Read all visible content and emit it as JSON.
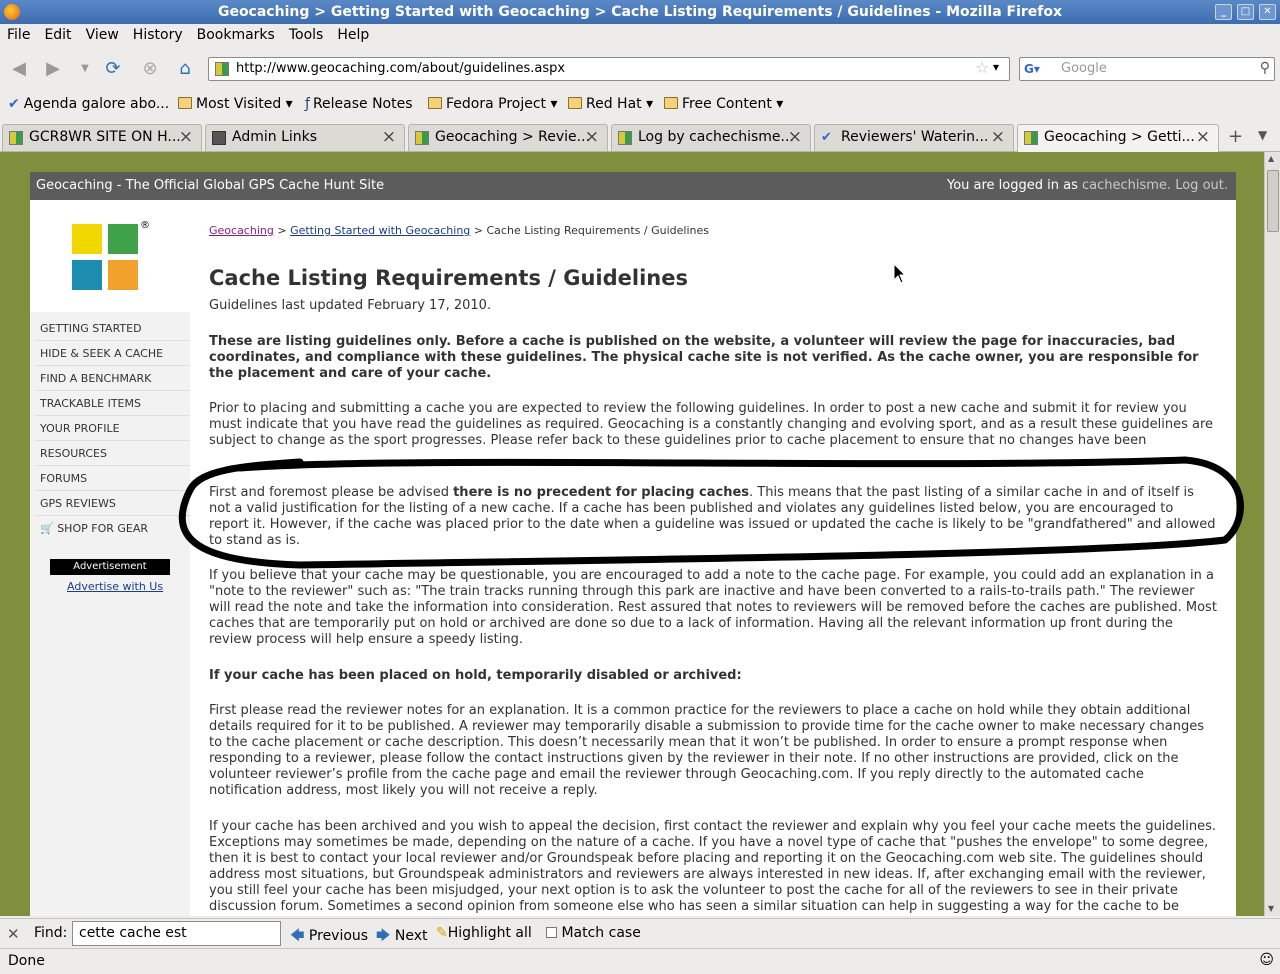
{
  "window": {
    "title": "Geocaching > Getting Started with Geocaching > Cache Listing Requirements / Guidelines - Mozilla Firefox"
  },
  "menu": [
    "File",
    "Edit",
    "View",
    "History",
    "Bookmarks",
    "Tools",
    "Help"
  ],
  "nav": {
    "url": "http://www.geocaching.com/about/guidelines.aspx",
    "search_placeholder": "Google"
  },
  "bookmarks": [
    "Agenda galore abo...",
    "Most Visited",
    "Release Notes",
    "Fedora Project",
    "Red Hat",
    "Free Content"
  ],
  "tabs": [
    {
      "label": "GCR8WR SITE ON H..."
    },
    {
      "label": "Admin Links"
    },
    {
      "label": "Geocaching > Revie..."
    },
    {
      "label": "Log by cachechisme..."
    },
    {
      "label": "Reviewers' Waterin..."
    },
    {
      "label": "Geocaching > Getti..."
    }
  ],
  "site": {
    "header_left": "Geocaching - The Official Global GPS Cache Hunt Site",
    "login_prefix": "You are logged in as",
    "username": "cachechisme.",
    "logout": "Log out."
  },
  "sidebar": {
    "items": [
      "Getting Started",
      "Hide & Seek a Cache",
      "Find a Benchmark",
      "Trackable Items",
      "Your Profile",
      "Resources",
      "Forums",
      "GPS Reviews",
      "Shop for Gear"
    ],
    "ad_label": "Advertisement",
    "ad_link": "Advertise with Us"
  },
  "breadcrumb": {
    "home": "Geocaching",
    "sep": ">",
    "section": "Getting Started with Geocaching",
    "current": "Cache Listing Requirements / Guidelines"
  },
  "article": {
    "title": "Cache Listing Requirements / Guidelines",
    "updated": "Guidelines last updated February 17, 2010.",
    "intro_bold": "These are listing guidelines only. Before a cache is published on the website, a volunteer will review the page for inaccuracies, bad coordinates, and compliance with these guidelines. The physical cache site is not verified. As the cache owner, you are responsible for the placement and care of your cache.",
    "p1": "Prior to placing and submitting a cache you are expected to review the following guidelines. In order to post a new cache and submit it for review you must indicate that you have read the guidelines as required. Geocaching is a constantly changing and evolving sport, and as a result these guidelines are subject to change as the sport progresses. Please refer back to these guidelines prior to cache placement to ensure that no changes have been implemented that would adversely affect your planned cache placement.",
    "p2_a": "First and foremost please be advised ",
    "p2_b": "there is no precedent for placing caches",
    "p2_c": ". This means that the past listing of a similar cache in and of itself is not a valid justification for the listing of a new cache. If a cache has been published and violates any guidelines listed below, you are encouraged to report it. However, if the cache was placed prior to the date when a guideline was issued or updated the cache is likely to be \"grandfathered\" and allowed to stand as is.",
    "p3": "If you believe that your cache may be questionable, you are encouraged to add a note to the cache page. For example, you could add an explanation in a \"note to the reviewer\" such as: \"The train tracks running through this park are inactive and have been converted to a rails-to-trails path.\" The reviewer will read the note and take the information into consideration. Rest assured that notes to reviewers will be removed before the caches are published. Most caches that are temporarily put on hold or archived are done so due to a lack of information. Having all the relevant information up front during the review process will help ensure a speedy listing.",
    "h2": "If your cache has been placed on hold, temporarily disabled or archived:",
    "p4": "First please read the reviewer notes for an explanation. It is a common practice for the reviewers to place a cache on hold while they obtain additional details required for it to be published. A reviewer may temporarily disable a submission to provide time for the cache owner to make necessary changes to the cache placement or cache description. This doesn’t necessarily mean that it won’t be published. In order to ensure a prompt response when responding to a reviewer, please follow the contact instructions given by the reviewer in their note. If no other instructions are provided, click on the volunteer reviewer’s profile from the cache page and email the reviewer through Geocaching.com. If you reply directly to the automated cache notification address, most likely you will not receive a reply.",
    "p5": "If your cache has been archived and you wish to appeal the decision, first contact the reviewer and explain why you feel your cache meets the guidelines. Exceptions may sometimes be made, depending on the nature of a cache. If you have a novel type of cache that \"pushes the envelope\" to some degree, then it is best to contact your local reviewer and/or Groundspeak before placing and reporting it on the Geocaching.com web site. The guidelines should address most situations, but Groundspeak administrators and reviewers are always interested in new ideas. If, after exchanging email with the reviewer, you still feel your cache has been misjudged, your next option is to ask the volunteer to post the cache for all of the reviewers to see in their private discussion forum. Sometimes a second opinion from someone else who has seen a similar situation can help in suggesting a way for the cache to be"
  },
  "find": {
    "label": "Find:",
    "value": "cette cache est",
    "previous": "Previous",
    "next": "Next",
    "highlight": "Highlight all",
    "match_case": "Match case"
  },
  "status": {
    "text": "Done"
  }
}
